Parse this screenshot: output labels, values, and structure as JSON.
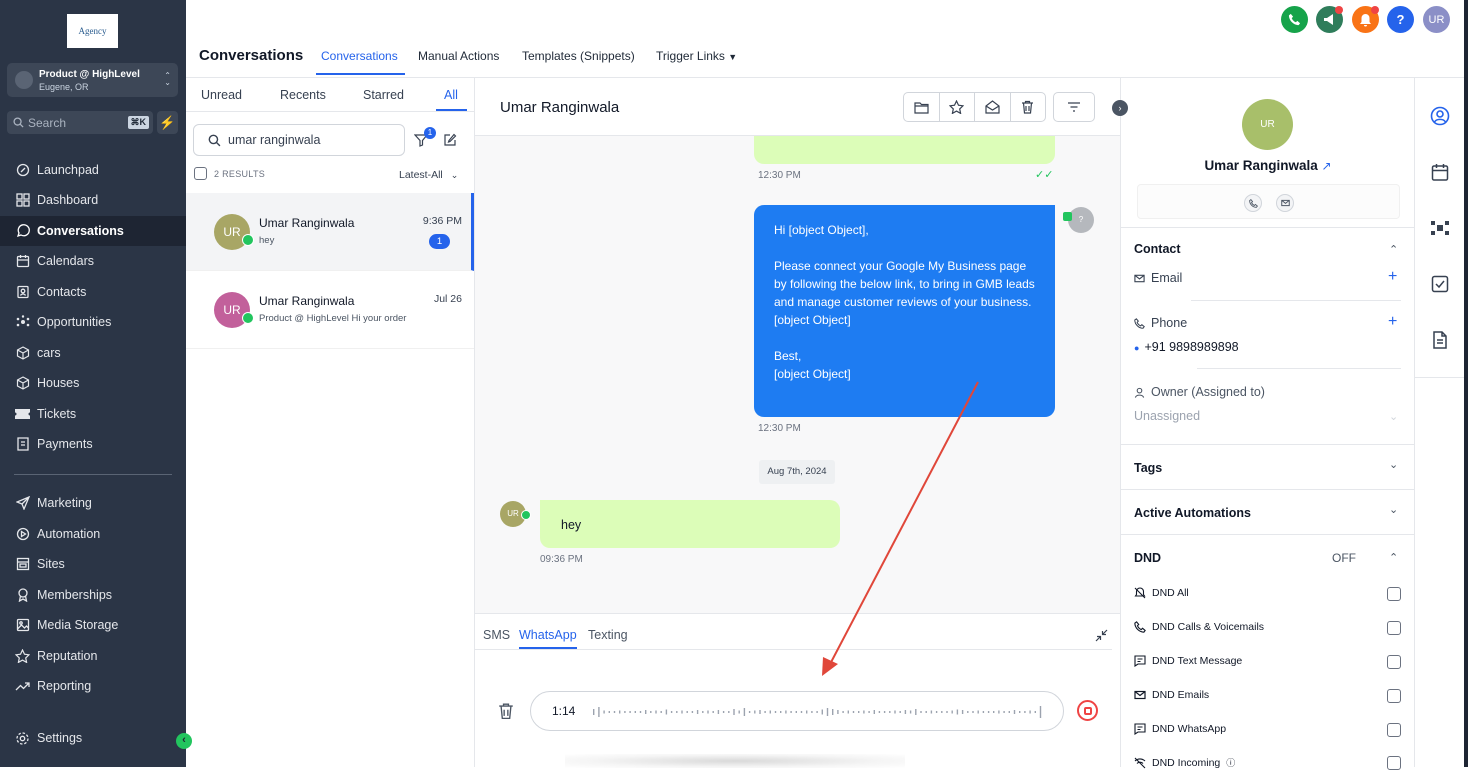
{
  "sidebar": {
    "logo_text": "Agency",
    "location": {
      "name": "Product @ HighLevel",
      "sub": "Eugene, OR"
    },
    "search": {
      "label": "Search",
      "shortcut": "⌘K"
    },
    "items": [
      {
        "label": "Launchpad",
        "icon": "rocket-icon"
      },
      {
        "label": "Dashboard",
        "icon": "grid-icon"
      },
      {
        "label": "Conversations",
        "icon": "chat-icon"
      },
      {
        "label": "Calendars",
        "icon": "calendar-icon"
      },
      {
        "label": "Contacts",
        "icon": "contacts-icon"
      },
      {
        "label": "Opportunities",
        "icon": "opportunities-icon"
      },
      {
        "label": "cars",
        "icon": "box-icon"
      },
      {
        "label": "Houses",
        "icon": "box-icon"
      },
      {
        "label": "Tickets",
        "icon": "ticket-icon"
      },
      {
        "label": "Payments",
        "icon": "receipt-icon"
      },
      {
        "label": "Marketing",
        "icon": "send-icon"
      },
      {
        "label": "Automation",
        "icon": "automation-icon"
      },
      {
        "label": "Sites",
        "icon": "sites-icon"
      },
      {
        "label": "Memberships",
        "icon": "award-icon"
      },
      {
        "label": "Media Storage",
        "icon": "image-icon"
      },
      {
        "label": "Reputation",
        "icon": "star-icon"
      },
      {
        "label": "Reporting",
        "icon": "trend-icon"
      },
      {
        "label": "Settings",
        "icon": "gear-icon"
      }
    ]
  },
  "header": {
    "title": "Conversations",
    "tabs": [
      "Conversations",
      "Manual Actions",
      "Templates (Snippets)",
      "Trigger Links"
    ],
    "avatar": "UR",
    "help": "?"
  },
  "list": {
    "tabs": [
      "Unread",
      "Recents",
      "Starred",
      "All"
    ],
    "search_value": "umar ranginwala",
    "filter_count": "1",
    "results": "2 RESULTS",
    "sort": "Latest-All",
    "items": [
      {
        "initials": "UR",
        "name": "Umar Ranginwala",
        "preview": "hey",
        "time": "9:36 PM",
        "badge": "1"
      },
      {
        "initials": "UR",
        "name": "Umar Ranginwala",
        "preview": "Product @ HighLevel Hi your order",
        "time": "Jul 26"
      }
    ]
  },
  "chat": {
    "contact_name": "Umar Ranginwala",
    "messages": [
      {
        "time": "12:30 PM"
      },
      {
        "text": "Hi [object Object],\n\nPlease connect your Google My Business page by following the below link, to bring in GMB leads and manage customer reviews of your business.\n[object Object]\n\nBest,\n[object Object]",
        "time": "12:30 PM",
        "avatar": "?"
      },
      {
        "date": "Aug 7th, 2024"
      },
      {
        "avatar": "UR",
        "text": "hey",
        "time": "09:36 PM"
      }
    ],
    "composer": {
      "tabs": [
        "SMS",
        "WhatsApp",
        "Texting"
      ],
      "recording_time": "1:14"
    }
  },
  "contact_panel": {
    "initials": "UR",
    "name": "Umar Ranginwala",
    "contact_heading": "Contact",
    "email_label": "Email",
    "phone_label": "Phone",
    "phone_value": "+91 9898989898",
    "owner_label": "Owner (Assigned to)",
    "owner_value": "Unassigned",
    "tags": "Tags",
    "automations": "Active Automations",
    "dnd": {
      "heading": "DND",
      "status": "OFF",
      "items": [
        "DND All",
        "DND Calls & Voicemails",
        "DND Text Message",
        "DND Emails",
        "DND WhatsApp",
        "DND Incoming"
      ]
    }
  },
  "colors": {
    "sidebar": "#2b3546",
    "accent": "#2563eb",
    "outgoing_bubble": "#1e7cf2",
    "incoming_bubble": "#dcfdb8",
    "annotation_arrow": "#e0473a"
  }
}
